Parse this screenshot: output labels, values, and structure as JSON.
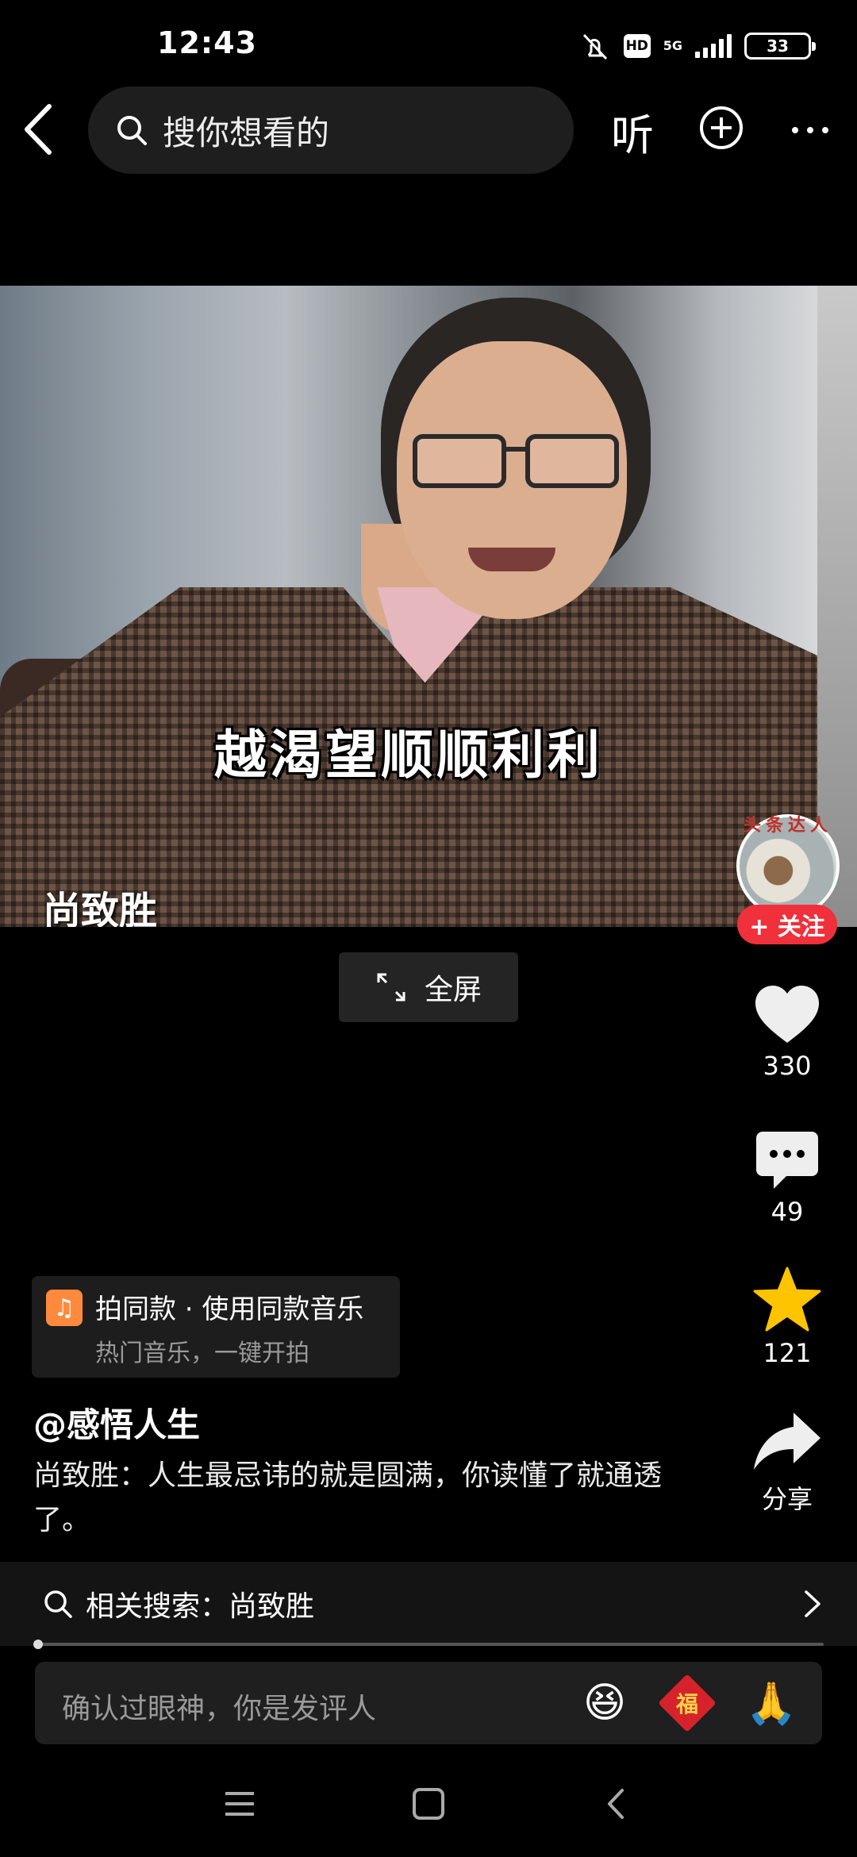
{
  "status_bar": {
    "time": "12:43",
    "network": "5G",
    "hd": "HD",
    "battery": "33"
  },
  "top_nav": {
    "search_placeholder": "搜你想看的",
    "listen_label": "听"
  },
  "video": {
    "subtitle": "越渴望顺顺利利",
    "speaker_watermark": "尚致胜",
    "fullscreen_label": "全屏"
  },
  "creator": {
    "badge_text": "头条达人",
    "follow_label": "+ 关注"
  },
  "actions": {
    "likes": "330",
    "comments": "49",
    "favorites": "121",
    "share_label": "分享"
  },
  "music": {
    "title": "拍同款 · 使用同款音乐",
    "subtitle": "热门音乐，一键开拍"
  },
  "post": {
    "author": "@感悟人生",
    "description": "尚致胜：人生最忌讳的就是圆满，你读懂了就通透了。"
  },
  "related_search": {
    "text": "相关搜索：尚致胜"
  },
  "comment_input": {
    "placeholder": "确认过眼神，你是发评人"
  },
  "colors": {
    "accent_red": "#f0303a",
    "star_yellow": "#ffc400",
    "music_orange": "#ff8a3d"
  }
}
